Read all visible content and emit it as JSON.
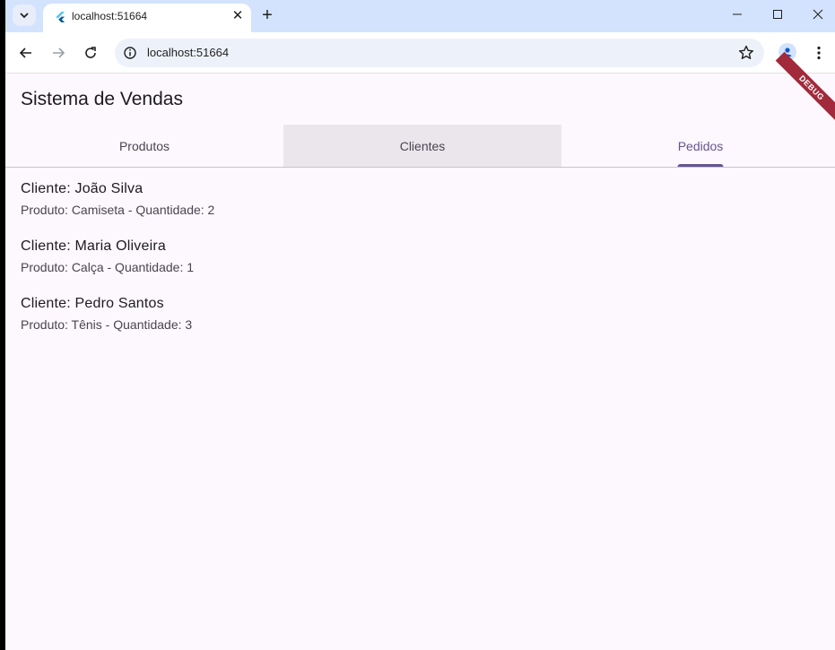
{
  "browser": {
    "tab_title": "localhost:51664",
    "url": "localhost:51664",
    "close_glyph": "✕",
    "new_tab_glyph": "+"
  },
  "app": {
    "title": "Sistema de Vendas",
    "debug_label": "DEBUG",
    "tabs": [
      {
        "label": "Produtos"
      },
      {
        "label": "Clientes"
      },
      {
        "label": "Pedidos"
      }
    ],
    "active_tab": "Pedidos",
    "orders": [
      {
        "client": "Cliente: João Silva",
        "detail": "Produto: Camiseta - Quantidade: 2"
      },
      {
        "client": "Cliente: Maria Oliveira",
        "detail": "Produto: Calça - Quantidade: 1"
      },
      {
        "client": "Cliente: Pedro Santos",
        "detail": "Produto: Tênis - Quantidade: 3"
      }
    ]
  },
  "colors": {
    "accent": "#65558f",
    "background": "#fdf7fe",
    "tab_hover": "#ebe5ec",
    "debug": "#a12a3b"
  },
  "icons": [
    "tab-search-icon",
    "flutter-icon",
    "close-icon",
    "new-tab-icon",
    "minimize-icon",
    "maximize-icon",
    "window-close-icon",
    "back-icon",
    "forward-icon",
    "reload-icon",
    "site-info-icon",
    "bookmark-star-icon",
    "profile-icon",
    "menu-icon"
  ]
}
